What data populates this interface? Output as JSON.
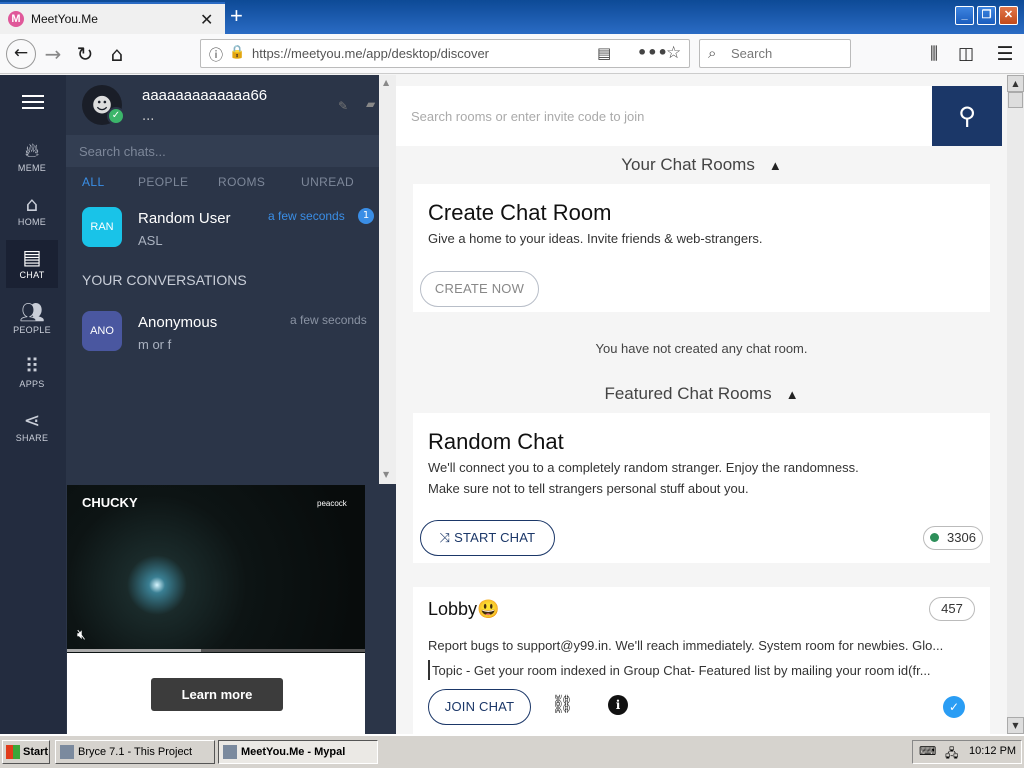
{
  "browser": {
    "tab_title": "MeetYou.Me",
    "tab_favicon_letter": "M",
    "url": "https://meetyou.me/app/desktop/discover",
    "search_placeholder": "Search"
  },
  "rail": {
    "items": [
      {
        "label": "MEME",
        "icon": "flame-icon"
      },
      {
        "label": "HOME",
        "icon": "home-icon"
      },
      {
        "label": "CHAT",
        "icon": "chat-icon"
      },
      {
        "label": "PEOPLE",
        "icon": "people-icon"
      },
      {
        "label": "APPS",
        "icon": "grid-icon"
      },
      {
        "label": "SHARE",
        "icon": "share-icon"
      }
    ],
    "active": "CHAT"
  },
  "profile": {
    "username": "aaaaaaaaaaaaa66",
    "status": "..."
  },
  "chat_list": {
    "search_placeholder": "Search chats...",
    "filters": [
      "ALL",
      "PEOPLE",
      "ROOMS",
      "UNREAD"
    ],
    "active_filter": "ALL",
    "pinned": {
      "avatar_text": "RAN",
      "name": "Random User",
      "message": "ASL",
      "time": "a few seconds",
      "unread": "1",
      "color": "#19c3e8"
    },
    "section_header": "YOUR CONVERSATIONS",
    "conversations": [
      {
        "avatar_text": "ANO",
        "name": "Anonymous",
        "message": "m or f",
        "time": "a few seconds",
        "color": "#4a57a0"
      }
    ]
  },
  "ad": {
    "brand": "CHUCKY",
    "network": "peacock",
    "cta": "Learn more",
    "progress": 0.45
  },
  "main": {
    "search_placeholder": "Search rooms or enter invite code to join",
    "your_rooms_title": "Your Chat Rooms",
    "create_card": {
      "title": "Create Chat Room",
      "description": "Give a home to your ideas. Invite friends & web-strangers.",
      "button": "CREATE NOW"
    },
    "no_rooms_text": "You have not created any chat room.",
    "featured_title": "Featured Chat Rooms",
    "random_card": {
      "title": "Random Chat",
      "desc_line1": "We'll connect you to a completely random stranger. Enjoy the randomness.",
      "desc_line2": "Make sure not to tell strangers personal stuff about you.",
      "button": "START CHAT",
      "online": "3306"
    },
    "lobby_card": {
      "title": "Lobby😃",
      "count": "457",
      "description": "Report bugs to support@y99.in. We'll reach immediately. System room for newbies. Glo...",
      "topic": "Topic - Get your room indexed in Group Chat- Featured list by mailing your room id(fr...",
      "button": "JOIN CHAT"
    }
  },
  "taskbar": {
    "start": "Start",
    "tasks": [
      "Bryce 7.1 - This Project",
      "MeetYou.Me - Mypal"
    ],
    "active_task": "MeetYou.Me - Mypal",
    "clock": "10:12 PM"
  }
}
